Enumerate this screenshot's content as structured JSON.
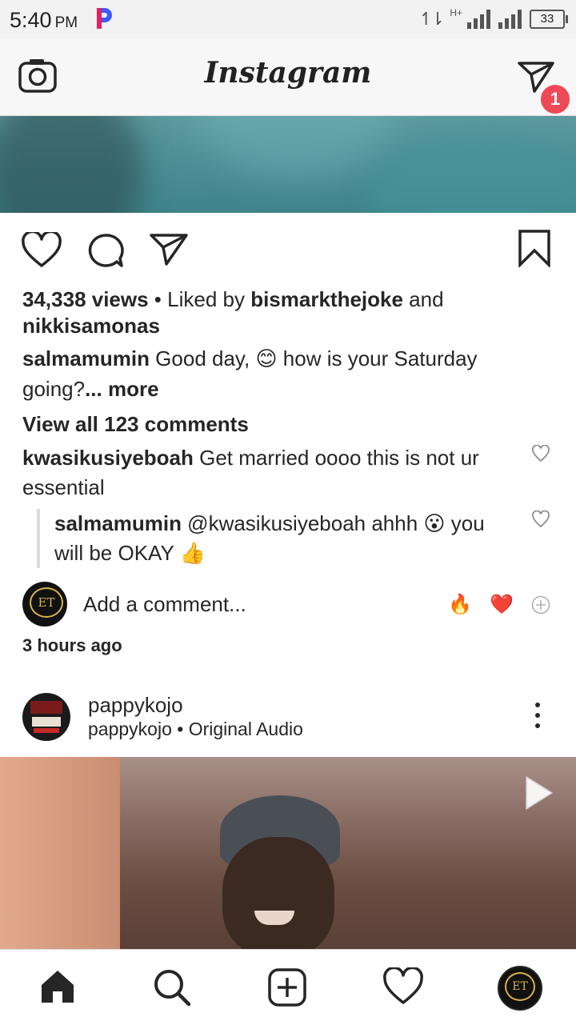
{
  "status_bar": {
    "time": "5:40",
    "ampm": "PM",
    "network": "H+",
    "battery": "33"
  },
  "header": {
    "brand": "Instagram",
    "dm_badge": "1",
    "icons": [
      "camera-icon",
      "direct-message-icon"
    ]
  },
  "post": {
    "views": "34,338 views",
    "liked_by_prefix": " • Liked by ",
    "liked_by_user": "bismarkthejoke",
    "liked_by_and": " and",
    "liked_by_user2": "nikkisamonas",
    "caption_user": "salmamumin",
    "caption_text_1": " Good day, 😊 how is your Saturday",
    "caption_text_2": "going?",
    "caption_more": "... more",
    "view_all": "View all 123 comments",
    "comments": [
      {
        "user": "kwasikusiyeboah",
        "text_1": " Get married oooo this is not ur",
        "text_2": "essential"
      }
    ],
    "reply": {
      "user": "salmamumin",
      "text_1": " @kwasikusiyeboah ahhh 😮 you",
      "text_2": "will be OKAY 👍"
    },
    "add_comment": "Add a comment...",
    "quick_emojis": [
      "🔥",
      "❤️"
    ],
    "time_ago": "3 hours ago"
  },
  "next_post": {
    "username": "pappykojo",
    "sub_user": "pappykojo",
    "sub_sep": " • ",
    "sub_audio": "Original Audio"
  },
  "bottom_nav": {
    "items": [
      "home-icon",
      "search-icon",
      "new-post-icon",
      "activity-icon",
      "profile-avatar"
    ]
  },
  "colors": {
    "badge": "#ed4956",
    "text": "#262626",
    "media_top": "#4f9096"
  }
}
